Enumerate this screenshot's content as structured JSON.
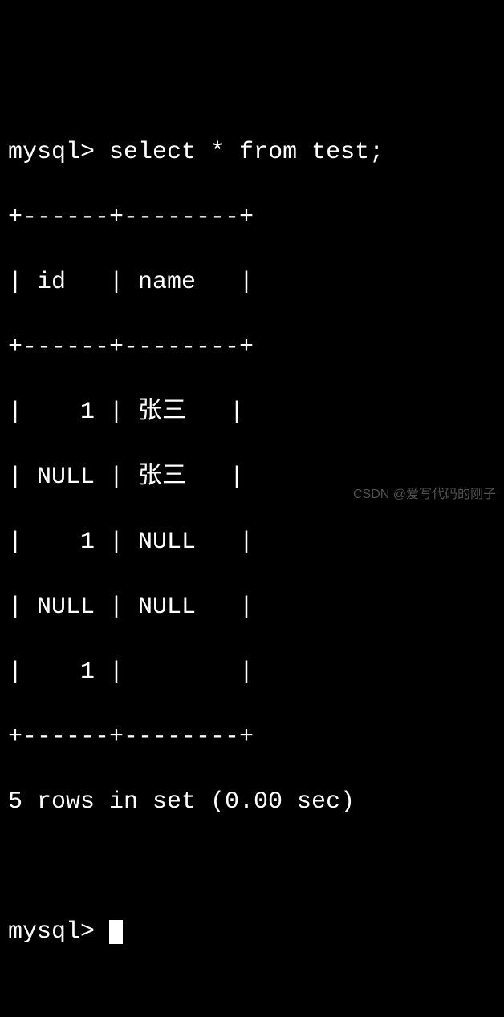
{
  "prompt": "mysql> ",
  "query": "select * from test;",
  "table": {
    "border_top": "+------+--------+",
    "header_row": "| id   | name   |",
    "border_mid": "+------+--------+",
    "rows": [
      "|    1 | 张三   |",
      "| NULL | 张三   |",
      "|    1 | NULL   |",
      "| NULL | NULL   |",
      "|    1 |        |"
    ],
    "border_bot": "+------+--------+"
  },
  "status": "5 rows in set (0.00 sec)",
  "prompt2": "mysql> ",
  "watermark": "CSDN @爱写代码的刚子",
  "chart_data": {
    "type": "table",
    "columns": [
      "id",
      "name"
    ],
    "data": [
      {
        "id": 1,
        "name": "张三"
      },
      {
        "id": null,
        "name": "张三"
      },
      {
        "id": 1,
        "name": null
      },
      {
        "id": null,
        "name": null
      },
      {
        "id": 1,
        "name": ""
      }
    ],
    "row_count": 5,
    "elapsed_sec": 0.0
  }
}
